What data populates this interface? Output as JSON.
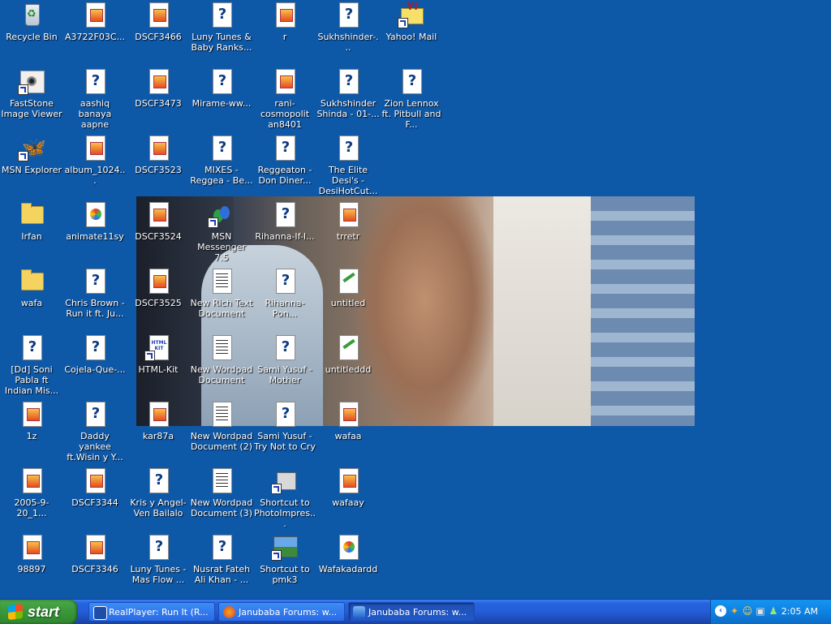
{
  "desktop": {
    "icons": [
      {
        "label": "Recycle Bin",
        "icon": "recycle-bin-icon"
      },
      {
        "label": "A3722F03C...",
        "icon": "image-file-icon"
      },
      {
        "label": "DSCF3466",
        "icon": "image-file-icon"
      },
      {
        "label": "Luny Tunes & Baby Ranks...",
        "icon": "realplayer-file-icon"
      },
      {
        "label": "r",
        "icon": "image-file-icon"
      },
      {
        "label": "Sukhshinder-...",
        "icon": "realplayer-file-icon"
      },
      {
        "label": "Yahoo! Mail",
        "icon": "yahoo-mail-icon"
      },
      {
        "label": "FastStone Image Viewer",
        "icon": "faststone-icon"
      },
      {
        "label": "aashiq banaya aapne",
        "icon": "realplayer-file-icon"
      },
      {
        "label": "DSCF3473",
        "icon": "image-file-icon"
      },
      {
        "label": "Mirame-ww...",
        "icon": "realplayer-file-icon"
      },
      {
        "label": "rani-cosmopolit an8401",
        "icon": "image-file-icon"
      },
      {
        "label": "Sukhshinder Shinda - 01-...",
        "icon": "realplayer-file-icon"
      },
      {
        "label": "Zion Lennox ft. Pitbull and F...",
        "icon": "realplayer-file-icon"
      },
      {
        "label": "MSN Explorer",
        "icon": "msn-explorer-icon"
      },
      {
        "label": "album_1024...",
        "icon": "image-file-icon"
      },
      {
        "label": "DSCF3523",
        "icon": "image-file-icon"
      },
      {
        "label": "MIXES - Reggea - Be...",
        "icon": "realplayer-file-icon"
      },
      {
        "label": "Reggeaton - Don Diner...",
        "icon": "realplayer-file-icon"
      },
      {
        "label": "The Elite Desi's - DesiHotCut...",
        "icon": "realplayer-file-icon"
      },
      {
        "label": "Irfan",
        "icon": "folder-icon"
      },
      {
        "label": "animate11sy",
        "icon": "colorful-file-icon"
      },
      {
        "label": "DSCF3524",
        "icon": "image-file-icon"
      },
      {
        "label": "MSN Messenger 7.5",
        "icon": "msn-messenger-icon"
      },
      {
        "label": "Rihanna-If-I...",
        "icon": "realplayer-file-icon"
      },
      {
        "label": "trretr",
        "icon": "image-file-icon"
      },
      {
        "label": "wafa",
        "icon": "folder-icon"
      },
      {
        "label": "Chris Brown - Run it ft. Ju...",
        "icon": "realplayer-file-icon"
      },
      {
        "label": "DSCF3525",
        "icon": "image-file-icon"
      },
      {
        "label": "New Rich Text Document",
        "icon": "wordpad-file-icon"
      },
      {
        "label": "Rihanna-Pon...",
        "icon": "realplayer-file-icon"
      },
      {
        "label": "untitled",
        "icon": "paint-file-icon"
      },
      {
        "label": "[Dd] Soni Pabla ft Indian Mis...",
        "icon": "realplayer-file-icon"
      },
      {
        "label": "Cojela-Que-...",
        "icon": "realplayer-file-icon"
      },
      {
        "label": "HTML-Kit",
        "icon": "html-kit-icon"
      },
      {
        "label": "New Wordpad Document",
        "icon": "wordpad-file-icon"
      },
      {
        "label": "Sami Yusuf - Mother",
        "icon": "realplayer-file-icon"
      },
      {
        "label": "untitleddd",
        "icon": "paint-file-icon"
      },
      {
        "label": "1z",
        "icon": "image-file-icon"
      },
      {
        "label": "Daddy yankee ft.Wisin y Y...",
        "icon": "realplayer-file-icon"
      },
      {
        "label": "kar87a",
        "icon": "image-file-icon"
      },
      {
        "label": "New Wordpad Document (2)",
        "icon": "wordpad-file-icon"
      },
      {
        "label": "Sami Yusuf - Try Not to Cry",
        "icon": "realplayer-file-icon"
      },
      {
        "label": "wafaa",
        "icon": "image-file-icon"
      },
      {
        "label": "2005-9-20_1...",
        "icon": "image-file-icon"
      },
      {
        "label": "DSCF3344",
        "icon": "image-file-icon"
      },
      {
        "label": "Kris y Angel- Ven Bailalo",
        "icon": "realplayer-file-icon"
      },
      {
        "label": "New Wordpad Document (3)",
        "icon": "wordpad-file-icon"
      },
      {
        "label": "Shortcut to PhotoImpres...",
        "icon": "photoimpression-shortcut-icon"
      },
      {
        "label": "wafaay",
        "icon": "image-file-icon"
      },
      {
        "label": "98897",
        "icon": "image-file-icon"
      },
      {
        "label": "DSCF3346",
        "icon": "image-file-icon"
      },
      {
        "label": "Luny Tunes - Mas Flow ...",
        "icon": "realplayer-file-icon"
      },
      {
        "label": "Nusrat Fateh Ali Khan - ...",
        "icon": "realplayer-file-icon"
      },
      {
        "label": "Shortcut to pmk3",
        "icon": "photo-shortcut-icon"
      },
      {
        "label": "Wafakadardd",
        "icon": "colorful-file-icon"
      }
    ]
  },
  "taskbar": {
    "start_label": "start",
    "tasks": [
      {
        "label": "RealPlayer: Run It (R...",
        "icon": "realplayer-icon"
      },
      {
        "label": "Janubaba Forums: w...",
        "icon": "firefox-icon"
      },
      {
        "label": "Janubaba Forums: w...",
        "icon": "internet-explorer-icon"
      }
    ],
    "tray_icons": [
      "show-hidden-icons-icon",
      "messenger-tray-icon",
      "smiley-tray-icon",
      "network-tray-icon",
      "users-tray-icon"
    ],
    "clock": "2:05 AM"
  },
  "colors": {
    "desktop": "#0e58a8",
    "taskbar": "#245dd7",
    "start": "#3c9b3c",
    "tray": "#0f82e0"
  }
}
